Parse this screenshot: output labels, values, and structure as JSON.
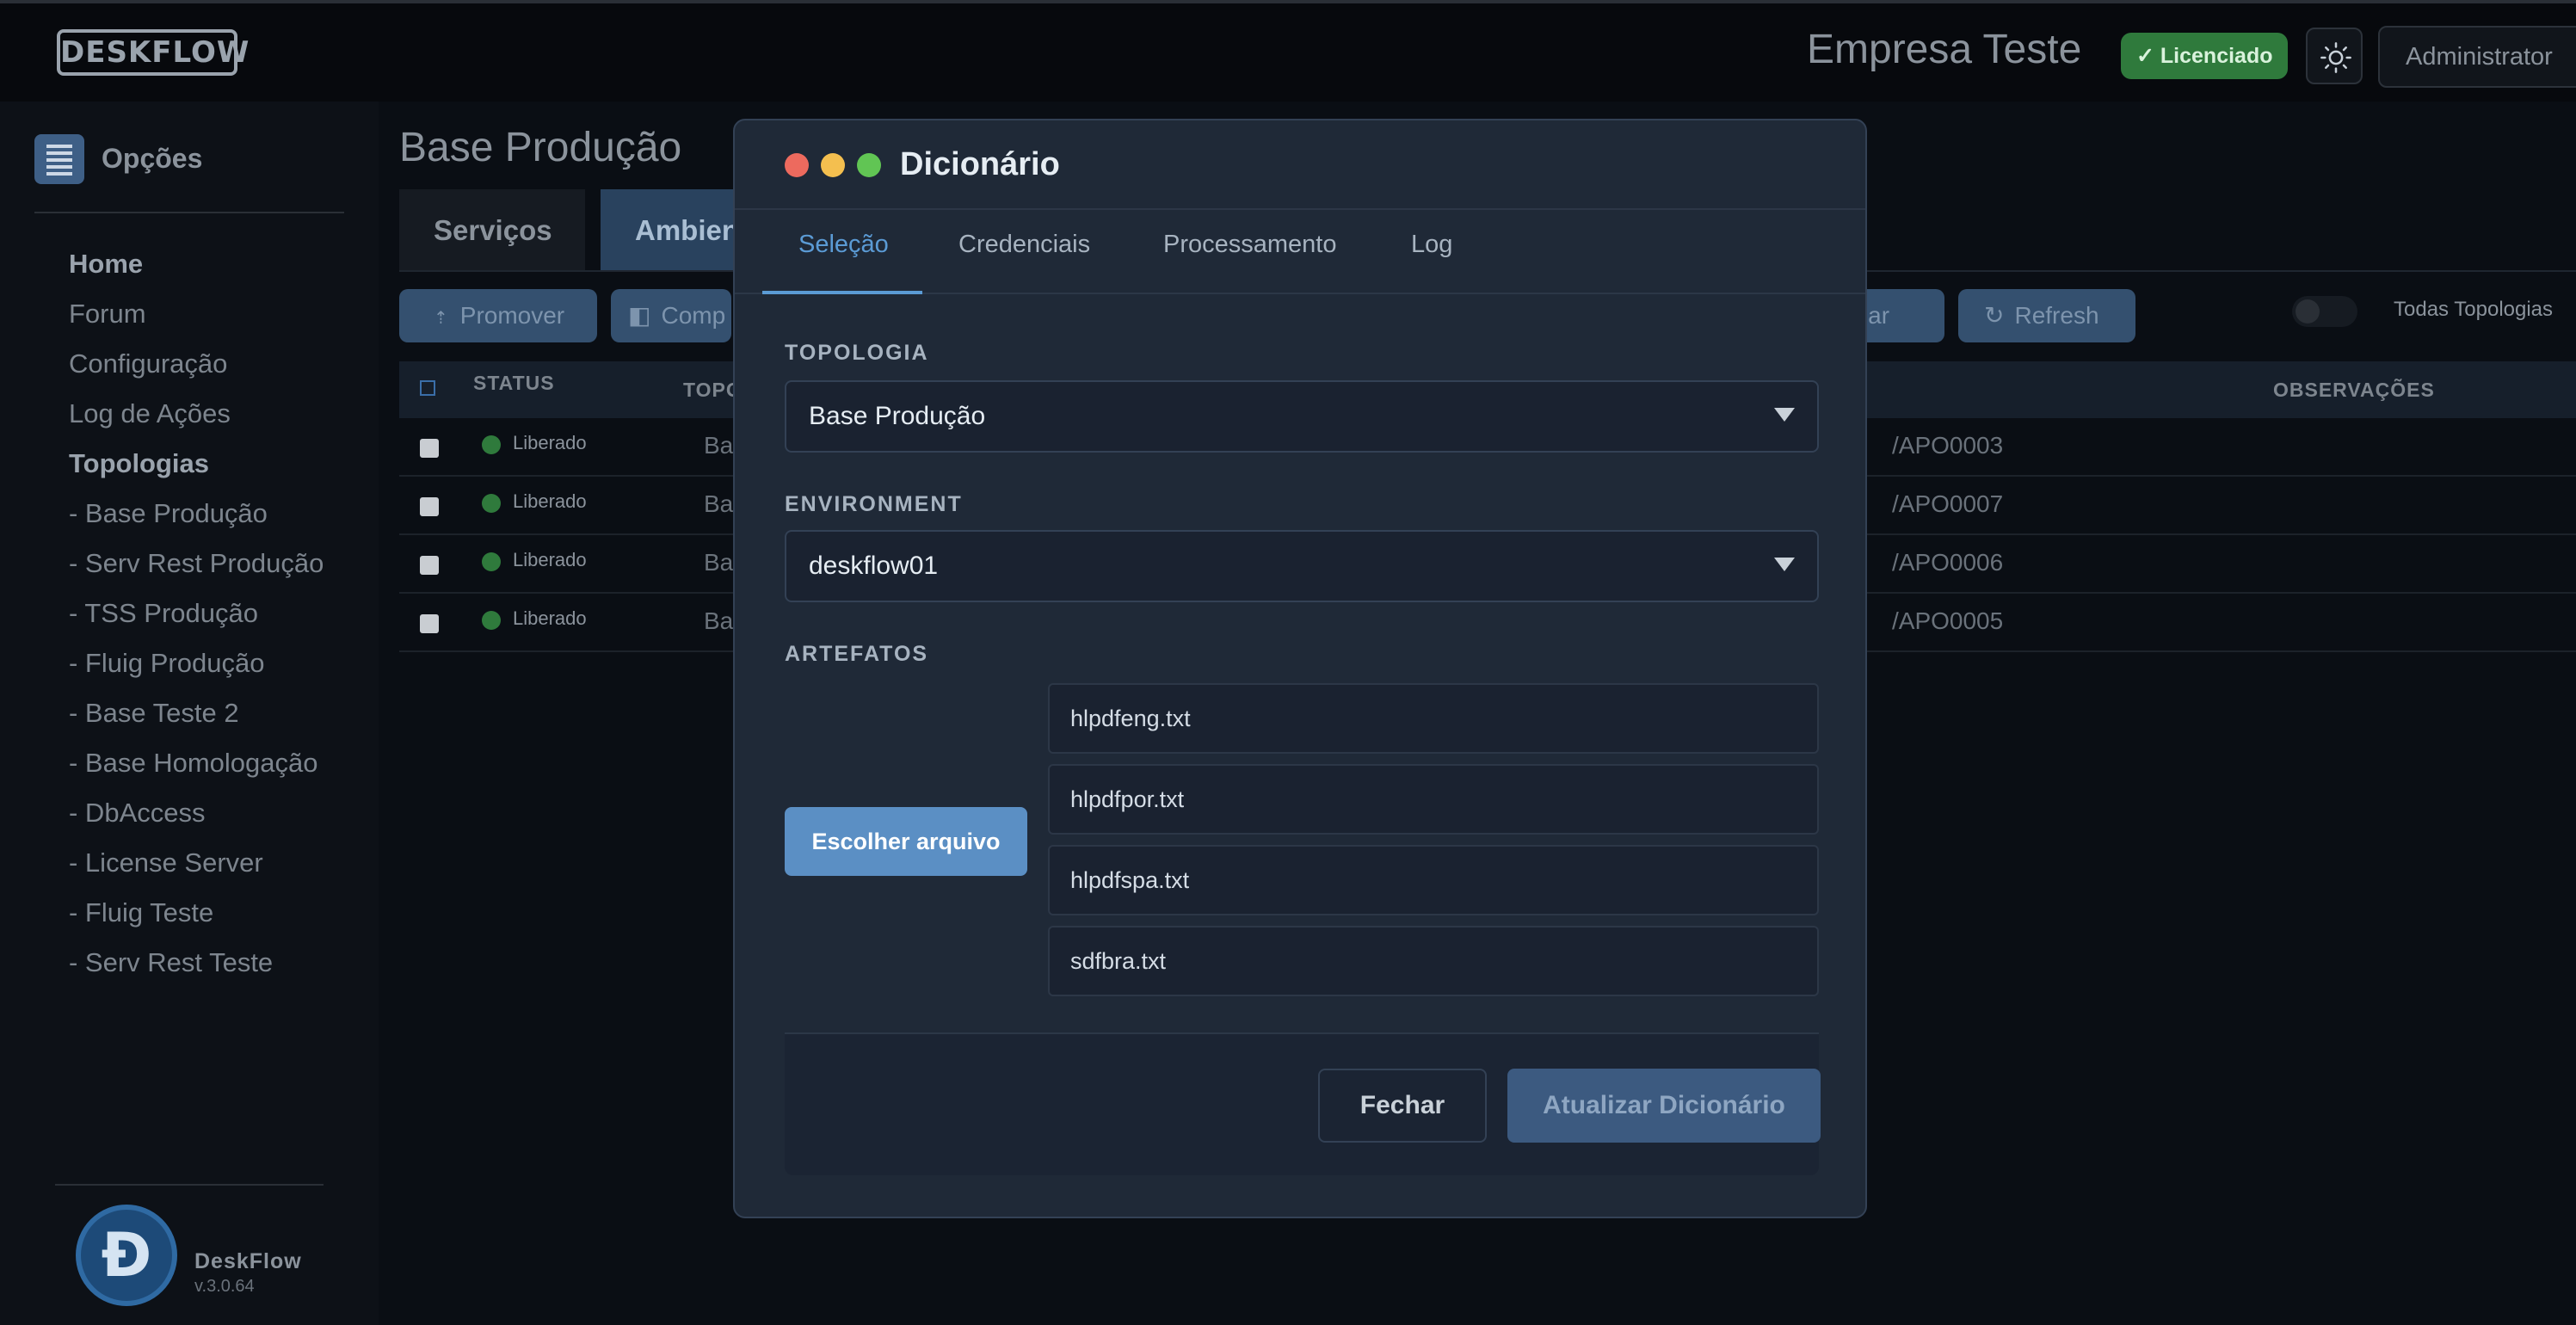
{
  "header": {
    "logo_text": "DESKFLOW",
    "company": "Empresa Teste",
    "license_badge": "✓ Licenciado",
    "user_button": "Administrator"
  },
  "sidebar": {
    "title": "Opções",
    "items": [
      {
        "label": "Home"
      },
      {
        "label": "Forum"
      },
      {
        "label": "Configuração"
      },
      {
        "label": "Log de Ações"
      }
    ],
    "section_title": "Topologias",
    "topologies": [
      "- Base Produção",
      "- Serv Rest Produção",
      "- TSS Produção",
      "- Fluig Produção",
      "- Base Teste 2",
      "- Base Homologação",
      "- DbAccess",
      "- License Server",
      "- Fluig Teste",
      "- Serv Rest Teste"
    ],
    "brand_name": "DeskFlow",
    "version": "v.3.0.64"
  },
  "main": {
    "page_title": "Base Produção",
    "tabs": [
      "Serviços",
      "Ambien"
    ],
    "actions": {
      "promover": "Promover",
      "comp": "Comp",
      "apagar": "agar",
      "refresh": "Refresh"
    },
    "toggle_label": "Todas Topologias",
    "table": {
      "headers": {
        "status": "STATUS",
        "topologia": "TOPO",
        "observacoes": "OBSERVAÇÕES"
      },
      "rows": [
        {
          "status": "Liberado",
          "topologia": "Base",
          "obs": "/APO0003"
        },
        {
          "status": "Liberado",
          "topologia": "Base",
          "obs": "/APO0007"
        },
        {
          "status": "Liberado",
          "topologia": "Base",
          "obs": "/APO0006"
        },
        {
          "status": "Liberado",
          "topologia": "Base",
          "obs": "/APO0005"
        }
      ]
    }
  },
  "modal": {
    "title": "Dicionário",
    "tabs": [
      "Seleção",
      "Credenciais",
      "Processamento",
      "Log"
    ],
    "topologia_label": "TOPOLOGIA",
    "topologia_value": "Base Produção",
    "environment_label": "ENVIRONMENT",
    "environment_value": "deskflow01",
    "artefatos_label": "ARTEFATOS",
    "choose_button": "Escolher arquivo",
    "files": [
      "hlpdfeng.txt",
      "hlpdfpor.txt",
      "hlpdfspa.txt",
      "sdfbra.txt"
    ],
    "close_button": "Fechar",
    "update_button": "Atualizar Dicionário"
  },
  "colors": {
    "accent": "#5b9bd5",
    "status_ok": "#2f7a3c",
    "window_close": "#ed6a5e",
    "window_min": "#f4bf4f",
    "window_max": "#61c554"
  },
  "icons": [
    "sun-icon",
    "list-icon",
    "upload-icon",
    "compare-icon",
    "refresh-icon",
    "chevron-down-icon"
  ]
}
